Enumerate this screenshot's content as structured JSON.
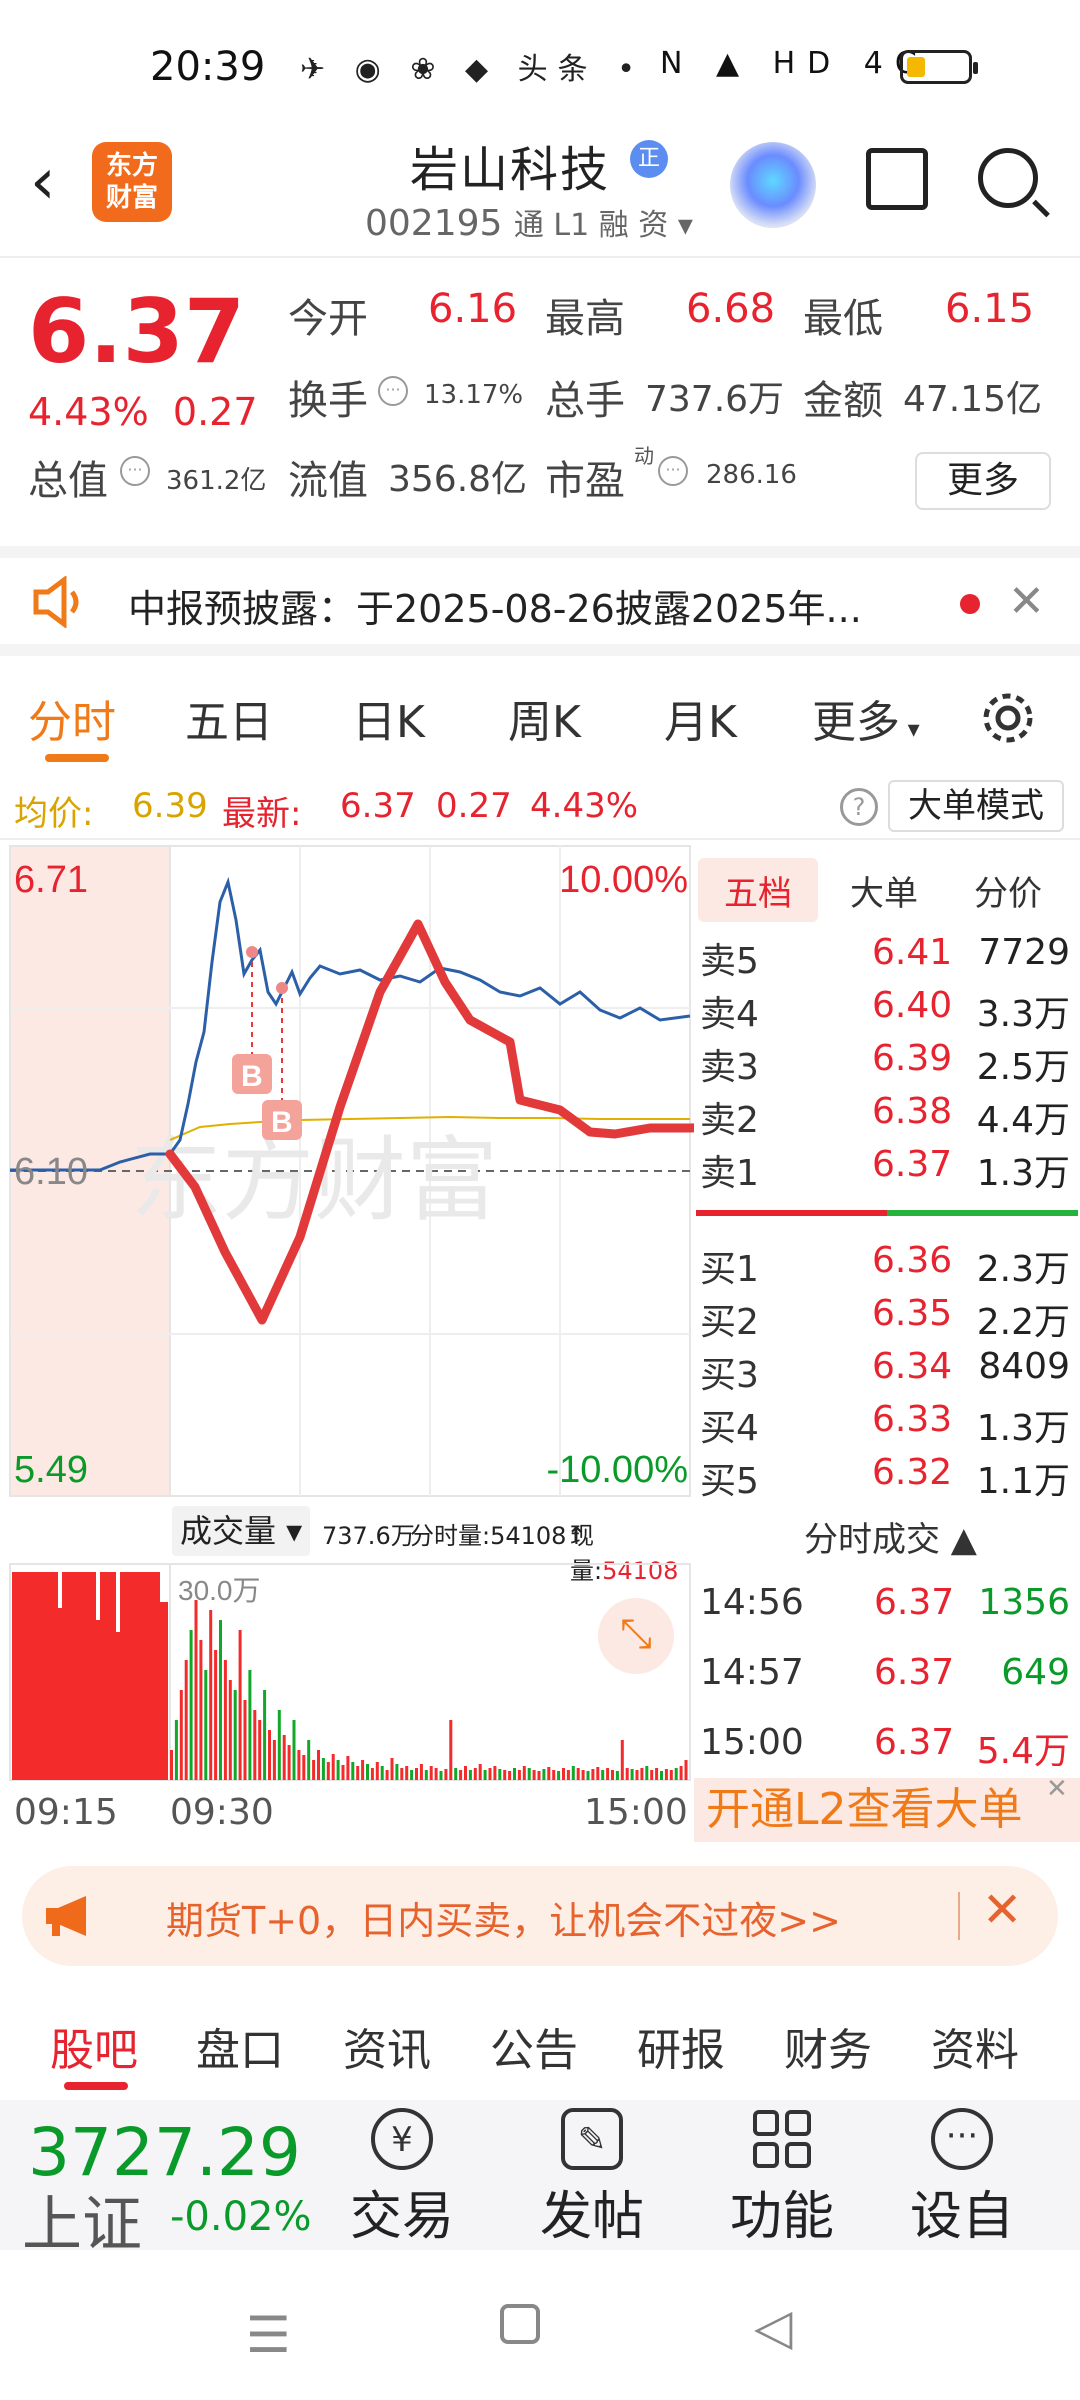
{
  "status_bar": {
    "time": "20:39",
    "app_icons": "✈ ◉ ❀ ◆ 头条 •",
    "system_icons": "N ▲ HD 4G"
  },
  "header": {
    "back": "‹",
    "logo_line1": "东方",
    "logo_line2": "财富",
    "stock_name": "岩山科技",
    "badge": "正",
    "stock_code": "002195",
    "code_tags": "通 L1   融 资 ▾"
  },
  "quote": {
    "price": "6.37",
    "change_pct": "4.43%",
    "change_amt": "0.27",
    "open_label": "今开",
    "open": "6.16",
    "high_label": "最高",
    "high": "6.68",
    "low_label": "最低",
    "low": "6.15",
    "turnover_label": "换手",
    "turnover": "13.17%",
    "volume_label": "总手",
    "volume": "737.6万",
    "amount_label": "金额",
    "amount": "47.15亿",
    "mktcap_label": "总值",
    "mktcap": "361.2亿",
    "float_label": "流值",
    "float_cap": "356.8亿",
    "pe_label": "市盈",
    "pe_sup": "动",
    "pe": "286.16",
    "more": "更多"
  },
  "notice": {
    "text": "中报预披露：于2025-08-26披露2025年..."
  },
  "tabs": [
    "分时",
    "五日",
    "日K",
    "周K",
    "月K",
    "更多"
  ],
  "avg_bar": {
    "avg_label": "均价:",
    "avg": "6.39",
    "latest_label": "最新:",
    "latest": "6.37",
    "chg": "0.27",
    "pct": "4.43%",
    "big_order": "大单模式"
  },
  "chart": {
    "y_top": "6.71",
    "y_mid": "6.10",
    "y_bottom": "5.49",
    "pct_top": "10.00%",
    "pct_bottom": "-10.00%",
    "marker": "B",
    "watermark": "东方财富"
  },
  "book": {
    "tabs": [
      "五档",
      "大单",
      "分价"
    ],
    "sells": [
      {
        "label": "卖5",
        "price": "6.41",
        "vol": "7729"
      },
      {
        "label": "卖4",
        "price": "6.40",
        "vol": "3.3万"
      },
      {
        "label": "卖3",
        "price": "6.39",
        "vol": "2.5万"
      },
      {
        "label": "卖2",
        "price": "6.38",
        "vol": "4.4万"
      },
      {
        "label": "卖1",
        "price": "6.37",
        "vol": "1.3万"
      }
    ],
    "buys": [
      {
        "label": "买1",
        "price": "6.36",
        "vol": "2.3万"
      },
      {
        "label": "买2",
        "price": "6.35",
        "vol": "2.2万"
      },
      {
        "label": "买3",
        "price": "6.34",
        "vol": "8409"
      },
      {
        "label": "买4",
        "price": "6.33",
        "vol": "1.3万"
      },
      {
        "label": "买5",
        "price": "6.32",
        "vol": "1.1万"
      }
    ]
  },
  "volume": {
    "selector": "成交量 ▾",
    "total": "737.6万",
    "tick_label": "分时量:54108↑",
    "now_label": "现量:",
    "now": "54108",
    "scale": "30.0万"
  },
  "time_axis": [
    "09:15",
    "09:30",
    "15:00"
  ],
  "ticks": {
    "title": "分时成交 ▲",
    "rows": [
      {
        "time": "14:56",
        "price": "6.37",
        "vol": "1356"
      },
      {
        "time": "14:57",
        "price": "6.37",
        "vol": "649"
      },
      {
        "time": "15:00",
        "price": "6.37",
        "vol": "5.4万"
      }
    ],
    "l2": "开通L2查看大单"
  },
  "promo": {
    "text": "期货T+0，日内买卖，让机会不过夜>>"
  },
  "sub_tabs": [
    "股吧",
    "盘口",
    "资讯",
    "公告",
    "研报",
    "财务",
    "资料"
  ],
  "bottom": {
    "index_value": "3727.29",
    "index_name": "上证",
    "index_pct": "-0.02%",
    "items": [
      "交易",
      "发帖",
      "功能",
      "设自"
    ]
  }
}
